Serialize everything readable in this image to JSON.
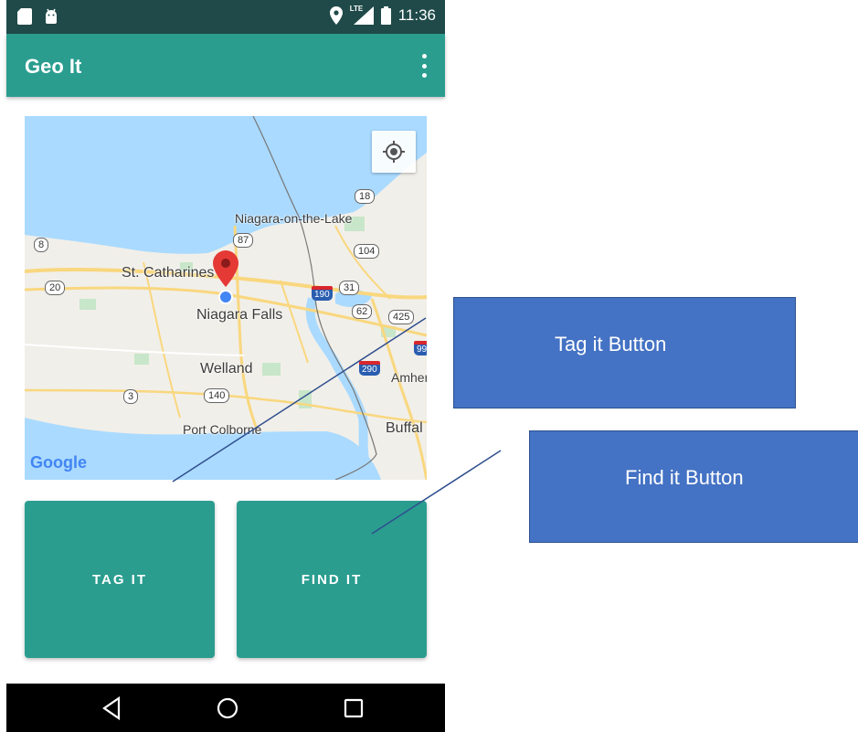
{
  "status_bar": {
    "time": "11:36",
    "icons": [
      "sd-card-icon",
      "android-icon",
      "location-icon",
      "lte-signal-icon",
      "battery-icon"
    ],
    "network_label": "LTE"
  },
  "app_bar": {
    "title": "Geo It",
    "menu_icon": "overflow-menu-icon"
  },
  "map": {
    "places": [
      "Niagara-on-the-Lake",
      "St. Catharines",
      "Niagara Falls",
      "Welland",
      "Port Colborne",
      "Amher",
      "Buffal"
    ],
    "routes": [
      "18",
      "87",
      "8",
      "104",
      "20",
      "31",
      "62",
      "425",
      "3",
      "140"
    ],
    "interstates": [
      "190",
      "290",
      "99"
    ],
    "attribution": "Google",
    "colors": {
      "water": "#aadaff",
      "land": "#f1efe9",
      "park": "#c8e6c9",
      "road": "#f9d77e",
      "marker": "#e53935",
      "my_location": "#4285f4"
    }
  },
  "buttons": {
    "tag_label": "TAG IT",
    "find_label": "FIND IT"
  },
  "annotations": {
    "tag_callout": "Tag it Button",
    "find_callout": "Find it Button"
  },
  "colors": {
    "primary": "#2a9d8f",
    "status_bar": "#1f4a49",
    "callout": "#4472c4"
  }
}
